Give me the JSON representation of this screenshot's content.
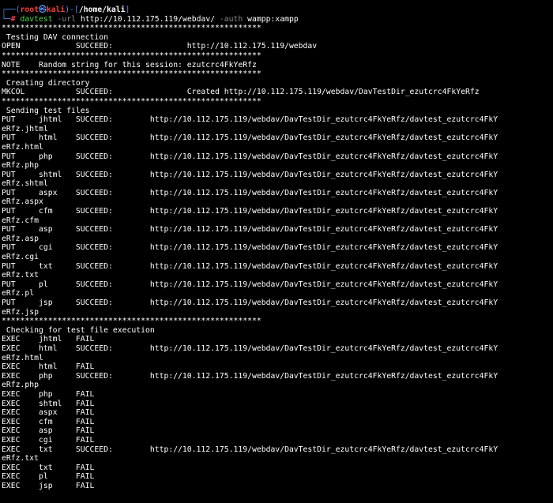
{
  "prompt": {
    "open": "┌──(",
    "user": "root",
    "at": "㉿",
    "host": "kali",
    "mid": ")-[",
    "path": "/home/kali",
    "close": "]",
    "line2": "└─",
    "hash": "#"
  },
  "command": {
    "name": "davtest",
    "flag_url": "-url",
    "url": "http://10.112.175.119/webdav/",
    "flag_auth": "-auth",
    "auth": "wampp:xampp"
  },
  "output": [
    "********************************************************",
    " Testing DAV connection",
    "OPEN            SUCCEED:                http://10.112.175.119/webdav",
    "********************************************************",
    "NOTE    Random string for this session: ezutcrc4FkYeRfz",
    "********************************************************",
    " Creating directory",
    "MKCOL           SUCCEED:                Created http://10.112.175.119/webdav/DavTestDir_ezutcrc4FkYeRfz",
    "********************************************************",
    " Sending test files",
    "PUT     jhtml   SUCCEED:        http://10.112.175.119/webdav/DavTestDir_ezutcrc4FkYeRfz/davtest_ezutcrc4FkY",
    "eRfz.jhtml",
    "PUT     html    SUCCEED:        http://10.112.175.119/webdav/DavTestDir_ezutcrc4FkYeRfz/davtest_ezutcrc4FkY",
    "eRfz.html",
    "PUT     php     SUCCEED:        http://10.112.175.119/webdav/DavTestDir_ezutcrc4FkYeRfz/davtest_ezutcrc4FkY",
    "eRfz.php",
    "PUT     shtml   SUCCEED:        http://10.112.175.119/webdav/DavTestDir_ezutcrc4FkYeRfz/davtest_ezutcrc4FkY",
    "eRfz.shtml",
    "PUT     aspx    SUCCEED:        http://10.112.175.119/webdav/DavTestDir_ezutcrc4FkYeRfz/davtest_ezutcrc4FkY",
    "eRfz.aspx",
    "PUT     cfm     SUCCEED:        http://10.112.175.119/webdav/DavTestDir_ezutcrc4FkYeRfz/davtest_ezutcrc4FkY",
    "eRfz.cfm",
    "PUT     asp     SUCCEED:        http://10.112.175.119/webdav/DavTestDir_ezutcrc4FkYeRfz/davtest_ezutcrc4FkY",
    "eRfz.asp",
    "PUT     cgi     SUCCEED:        http://10.112.175.119/webdav/DavTestDir_ezutcrc4FkYeRfz/davtest_ezutcrc4FkY",
    "eRfz.cgi",
    "PUT     txt     SUCCEED:        http://10.112.175.119/webdav/DavTestDir_ezutcrc4FkYeRfz/davtest_ezutcrc4FkY",
    "eRfz.txt",
    "PUT     pl      SUCCEED:        http://10.112.175.119/webdav/DavTestDir_ezutcrc4FkYeRfz/davtest_ezutcrc4FkY",
    "eRfz.pl",
    "PUT     jsp     SUCCEED:        http://10.112.175.119/webdav/DavTestDir_ezutcrc4FkYeRfz/davtest_ezutcrc4FkY",
    "eRfz.jsp",
    "********************************************************",
    " Checking for test file execution",
    "EXEC    jhtml   FAIL",
    "EXEC    html    SUCCEED:        http://10.112.175.119/webdav/DavTestDir_ezutcrc4FkYeRfz/davtest_ezutcrc4FkY",
    "eRfz.html",
    "EXEC    html    FAIL",
    "EXEC    php     SUCCEED:        http://10.112.175.119/webdav/DavTestDir_ezutcrc4FkYeRfz/davtest_ezutcrc4FkY",
    "eRfz.php",
    "EXEC    php     FAIL",
    "EXEC    shtml   FAIL",
    "EXEC    aspx    FAIL",
    "EXEC    cfm     FAIL",
    "EXEC    asp     FAIL",
    "EXEC    cgi     FAIL",
    "EXEC    txt     SUCCEED:        http://10.112.175.119/webdav/DavTestDir_ezutcrc4FkYeRfz/davtest_ezutcrc4FkY",
    "eRfz.txt",
    "EXEC    txt     FAIL",
    "EXEC    pl      FAIL",
    "EXEC    jsp     FAIL"
  ]
}
